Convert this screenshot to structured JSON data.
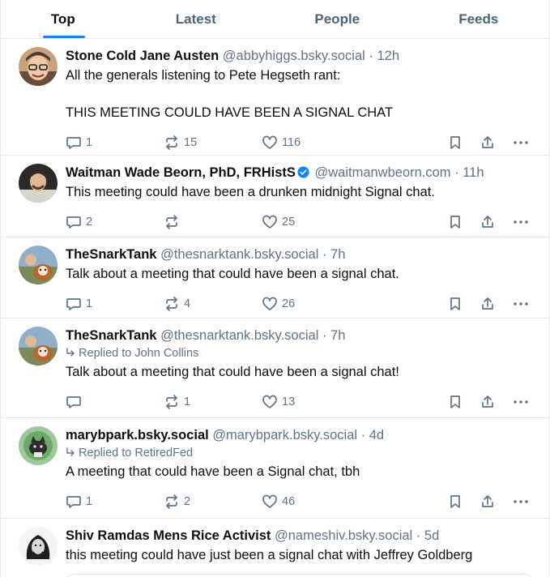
{
  "tabs": [
    {
      "label": "Top",
      "active": true
    },
    {
      "label": "Latest",
      "active": false
    },
    {
      "label": "People",
      "active": false
    },
    {
      "label": "Feeds",
      "active": false
    }
  ],
  "accent": "#1083fe",
  "posts": [
    {
      "name": "Stone Cold Jane Austen",
      "handle": "@abbyhiggs.bsky.social",
      "time": "12h",
      "text": "All the generals listening to Pete Hegseth rant:\n\nTHIS MEETING COULD HAVE BEEN A SIGNAL CHAT",
      "replies": "1",
      "reposts": "15",
      "likes": "116"
    },
    {
      "name": "Waitman Wade Beorn, PhD, FRHistS",
      "verified": true,
      "handle": "@waitmanwbeorn.com",
      "time": "11h",
      "text": "This meeting could have been a drunken midnight Signal chat.",
      "replies": "2",
      "reposts": "",
      "likes": "25"
    },
    {
      "name": "TheSnarkTank",
      "handle": "@thesnarktank.bsky.social",
      "time": "7h",
      "text": "Talk about a meeting that could have been a signal chat.",
      "replies": "1",
      "reposts": "4",
      "likes": "26"
    },
    {
      "name": "TheSnarkTank",
      "handle": "@thesnarktank.bsky.social",
      "time": "7h",
      "reply_to": "Replied to John Collins",
      "text": "Talk about a meeting that could have been a signal chat!",
      "replies": "",
      "reposts": "1",
      "likes": "13"
    },
    {
      "name": "marybpark.bsky.social",
      "handle": "@marybpark.bsky.social",
      "time": "4d",
      "reply_to": "Replied to RetiredFed",
      "text": "A meeting that could have been a Signal chat, tbh",
      "replies": "1",
      "reposts": "2",
      "likes": "46"
    },
    {
      "name": "Shiv Ramdas Mens Rice Activist",
      "handle": "@nameshiv.bsky.social",
      "time": "5d",
      "text": "this meeting could have just been a signal chat with Jeffrey Goldberg"
    }
  ],
  "separator": "·",
  "icons": {
    "reply": "reply-icon",
    "repost": "repost-icon",
    "like": "heart-icon",
    "bookmark": "bookmark-icon",
    "share": "share-icon",
    "more": "more-icon",
    "verified": "verified-check-icon",
    "reply_arrow": "reply-arrow-icon"
  }
}
